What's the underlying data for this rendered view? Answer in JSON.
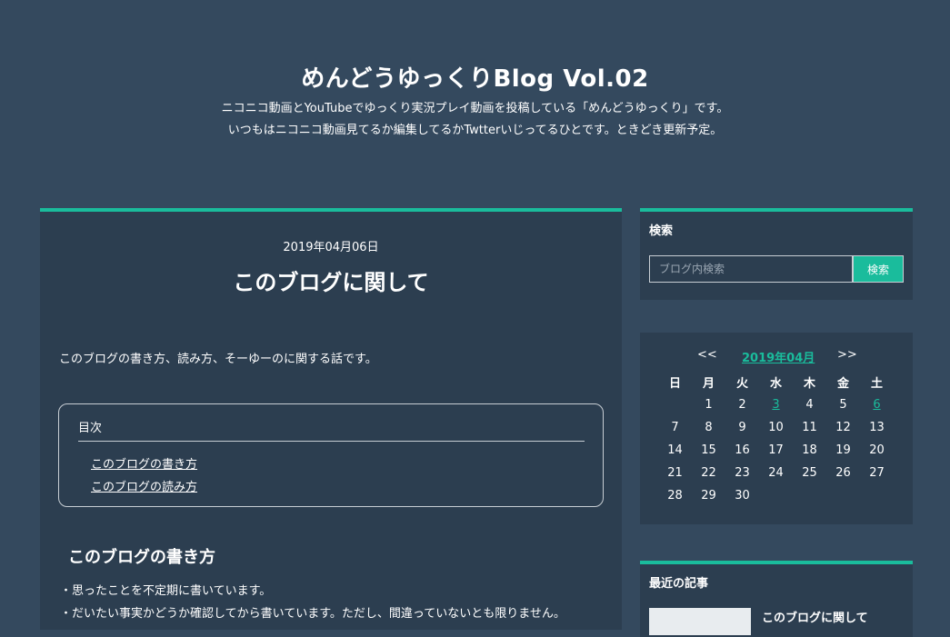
{
  "header": {
    "title": "めんどうゆっくりBlog Vol.02",
    "description_line1": "ニコニコ動画とYouTubeでゆっくり実況プレイ動画を投稿している「めんどうゆっくり」です。",
    "description_line2": "いつもはニコニコ動画見てるか編集してるかTwtterいじってるひとです。ときどき更新予定。"
  },
  "article": {
    "date": "2019年04月06日",
    "title": "このブログに関して",
    "intro": "このブログの書き方、読み方、そーゆーのに関する話です。",
    "toc": {
      "title": "目次",
      "items": [
        "このブログの書き方",
        "このブログの読み方"
      ]
    },
    "section_heading": "このブログの書き方",
    "section_lines": [
      "・思ったことを不定期に書いています。",
      "・だいたい事実かどうか確認してから書いています。ただし、間違っていないとも限りません。"
    ]
  },
  "sidebar": {
    "search": {
      "title": "検索",
      "placeholder": "ブログ内検索",
      "button_label": "検索"
    },
    "calendar": {
      "prev": "<<",
      "month": "2019年04月",
      "next": ">>",
      "weekdays": [
        "日",
        "月",
        "火",
        "水",
        "木",
        "金",
        "土"
      ],
      "weeks": [
        [
          "",
          "1",
          "2",
          "3",
          "4",
          "5",
          "6"
        ],
        [
          "7",
          "8",
          "9",
          "10",
          "11",
          "12",
          "13"
        ],
        [
          "14",
          "15",
          "16",
          "17",
          "18",
          "19",
          "20"
        ],
        [
          "21",
          "22",
          "23",
          "24",
          "25",
          "26",
          "27"
        ],
        [
          "28",
          "29",
          "30",
          "",
          "",
          "",
          ""
        ]
      ],
      "linked_days": [
        "3",
        "6"
      ]
    },
    "recent": {
      "title": "最近の記事",
      "items": [
        "このブログに関して"
      ]
    }
  },
  "colors": {
    "background": "#34495e",
    "panel": "#2c3e50",
    "accent": "#1abc9c",
    "text": "#ffffff"
  }
}
